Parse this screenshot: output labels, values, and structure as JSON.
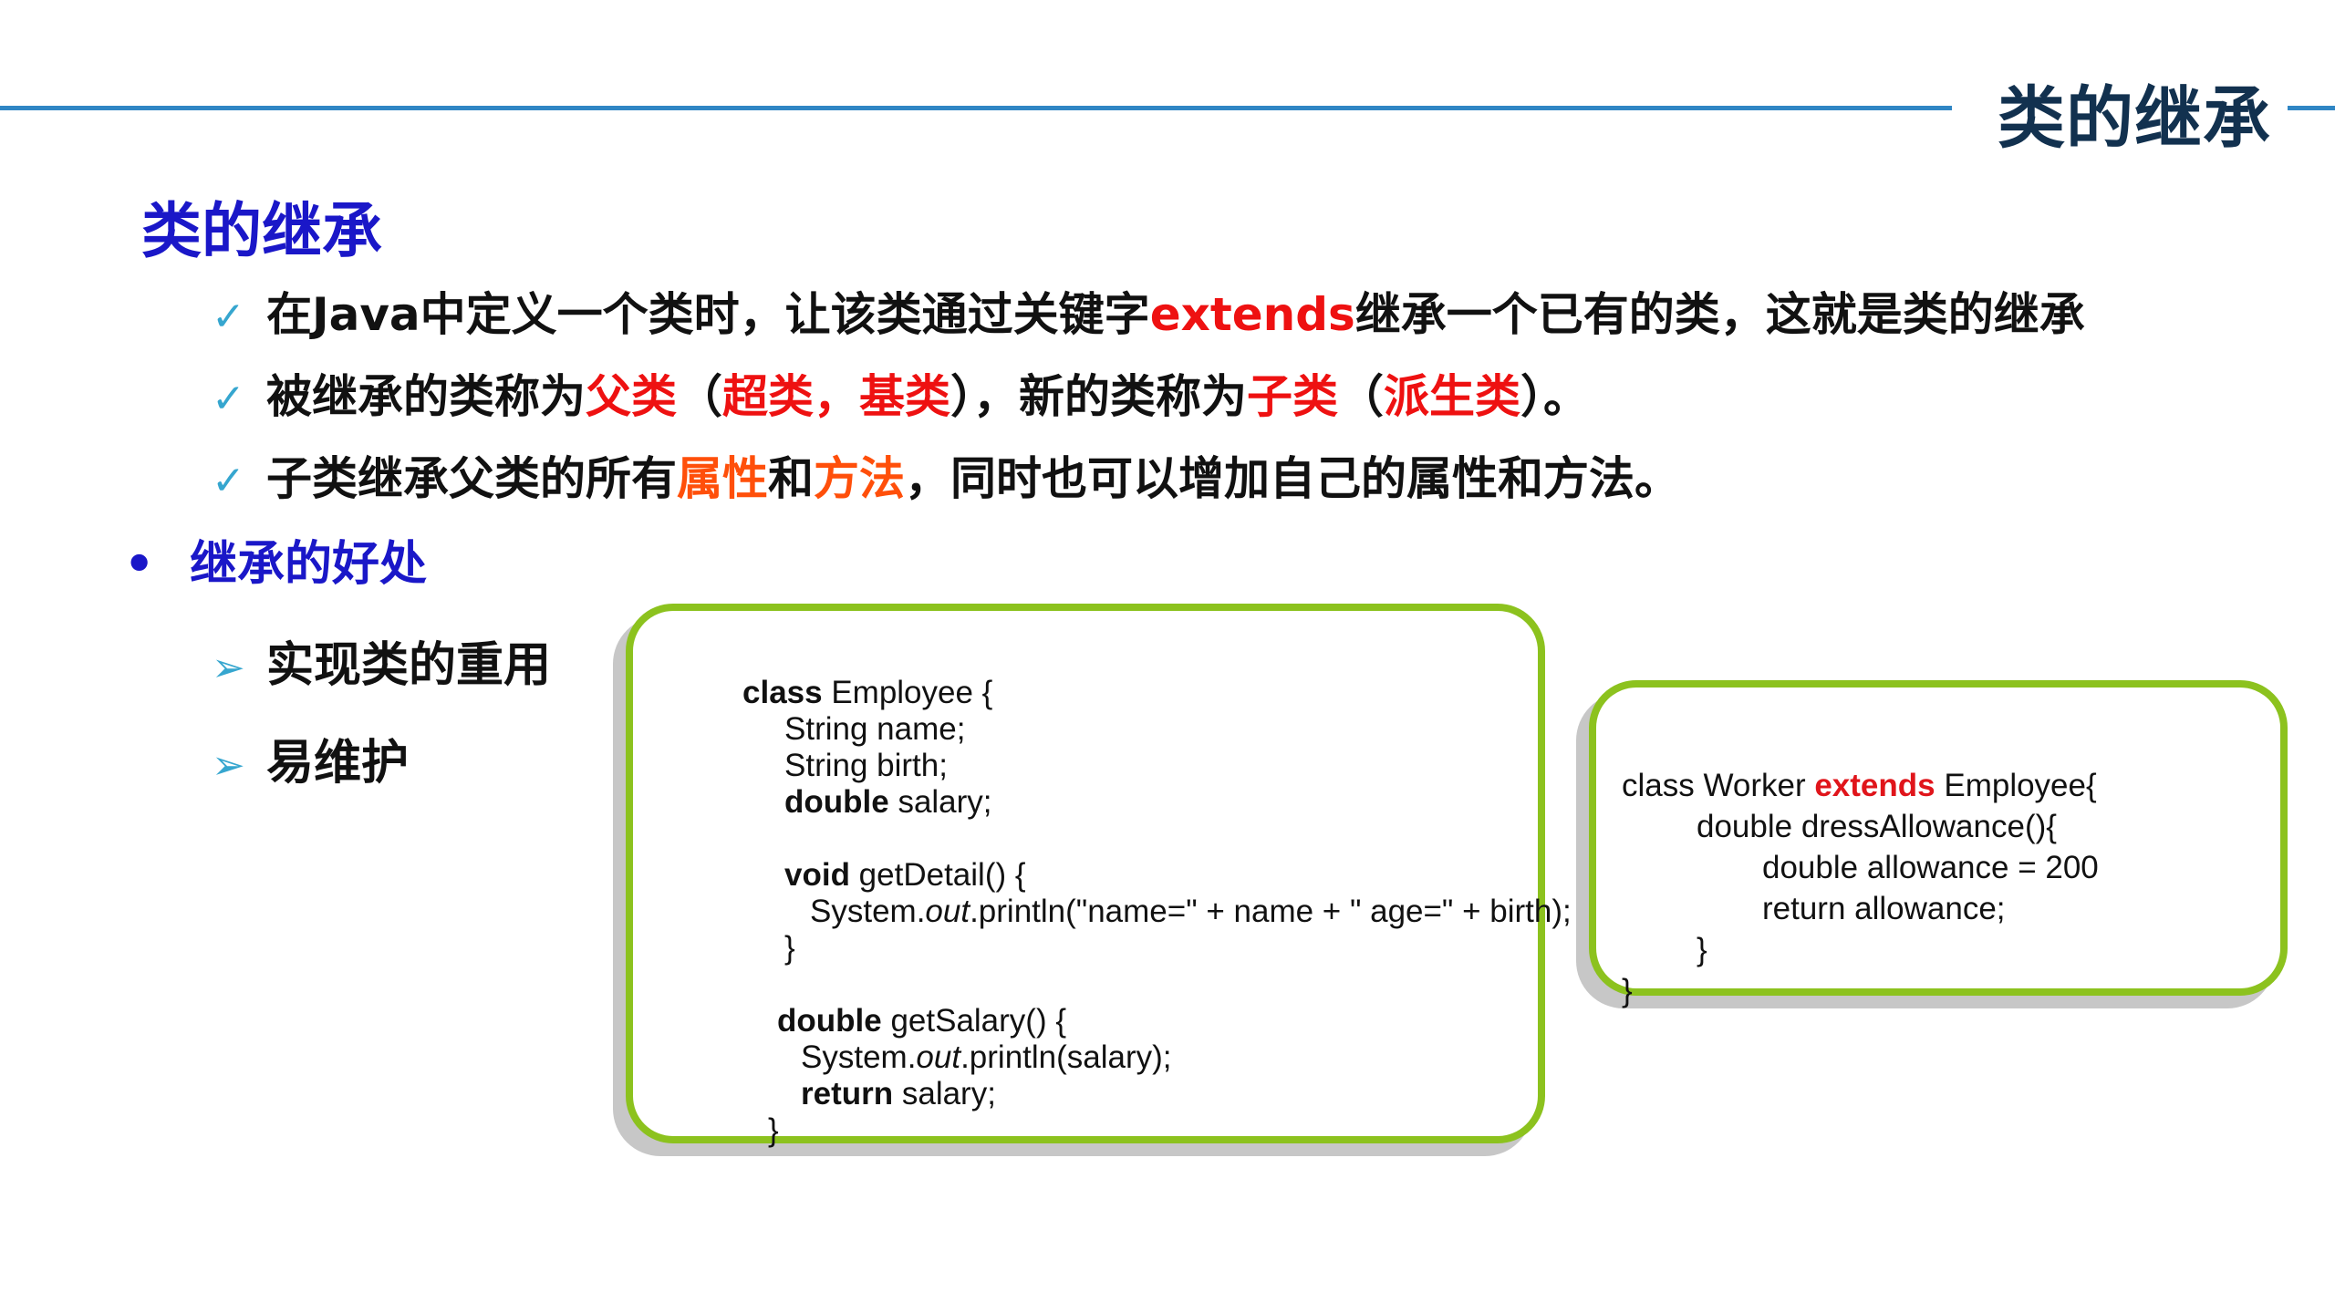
{
  "header": {
    "title": "类的继承"
  },
  "section": {
    "title": "类的继承"
  },
  "check_items": [
    {
      "mark": "✓",
      "parts": [
        "在Java中定义一个类时，让该类通过关键字",
        "extends",
        "继承一个已有的类，这就是类的继承"
      ]
    },
    {
      "mark": "✓",
      "parts": [
        "被继承的类称为",
        "父类",
        "（",
        "超类，基类",
        "），新的类称为",
        "子类",
        "（",
        "派生类",
        "）。"
      ]
    },
    {
      "mark": "✓",
      "parts": [
        "子类继承父类的所有",
        "属性",
        "和",
        "方法",
        "，同时也可以增加自己的属性和方法。"
      ]
    }
  ],
  "benefits": {
    "bullet": "•",
    "title": "继承的好处",
    "items": [
      {
        "mark": "➢",
        "label": "实现类的重用"
      },
      {
        "mark": "➢",
        "label": "易维护"
      }
    ]
  },
  "code_employee": {
    "l1_kw": "class",
    "l1_rest": " Employee {",
    "l2": "String name;",
    "l3": "String birth;",
    "l4_kw": "double",
    "l4_rest": " salary;",
    "l6_kw": "void",
    "l6_rest": " getDetail() {",
    "l7_a": "System.",
    "l7_b": "out",
    "l7_c": ".println(\"name=\" + name + \" age=\" + birth);",
    "l8": "}",
    "l10_kw": "double",
    "l10_rest": " getSalary() {",
    "l11_a": "System.",
    "l11_b": "out",
    "l11_c": ".println(salary);",
    "l12_kw": "return",
    "l12_rest": " salary;",
    "l13": "}"
  },
  "code_worker": {
    "l1_a": "class Worker ",
    "l1_kw": "extends",
    "l1_c": " Employee{",
    "l2": "double dressAllowance(){",
    "l3": "double allowance = 200",
    "l4": "return allowance;",
    "l5": "}",
    "l6": "}"
  },
  "colors": {
    "accent_blue": "#1a17c8",
    "header_line": "#2f86c4",
    "highlight_red": "#ee1111",
    "highlight_orange": "#ff4f0a",
    "box_border": "#8cc21e"
  }
}
